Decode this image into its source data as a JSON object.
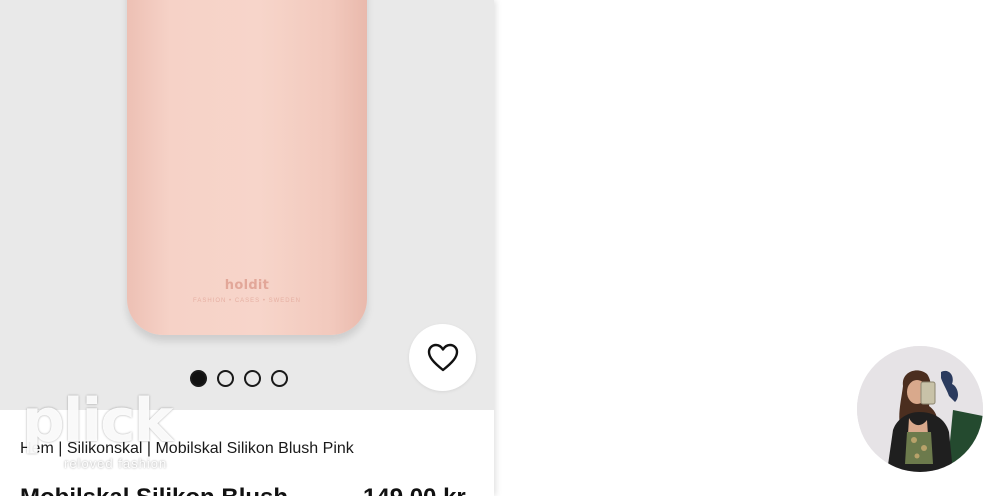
{
  "product": {
    "case_brand": "holdit",
    "case_tagline": "FASHION • CASES • SWEDEN",
    "breadcrumb": "Hem | Silikonskal | Mobilskal Silikon Blush Pink",
    "title": "Mobilskal Silikon Blush",
    "price": "149,00 kr",
    "color": "#f6d2c7",
    "favorite_icon": "heart-outline-icon"
  },
  "gallery": {
    "slide_count": 4,
    "active_index": 0
  },
  "watermark": {
    "text": "plick",
    "subtext": "reloved fashion"
  },
  "profile": {
    "icon": "user-avatar-photo"
  }
}
